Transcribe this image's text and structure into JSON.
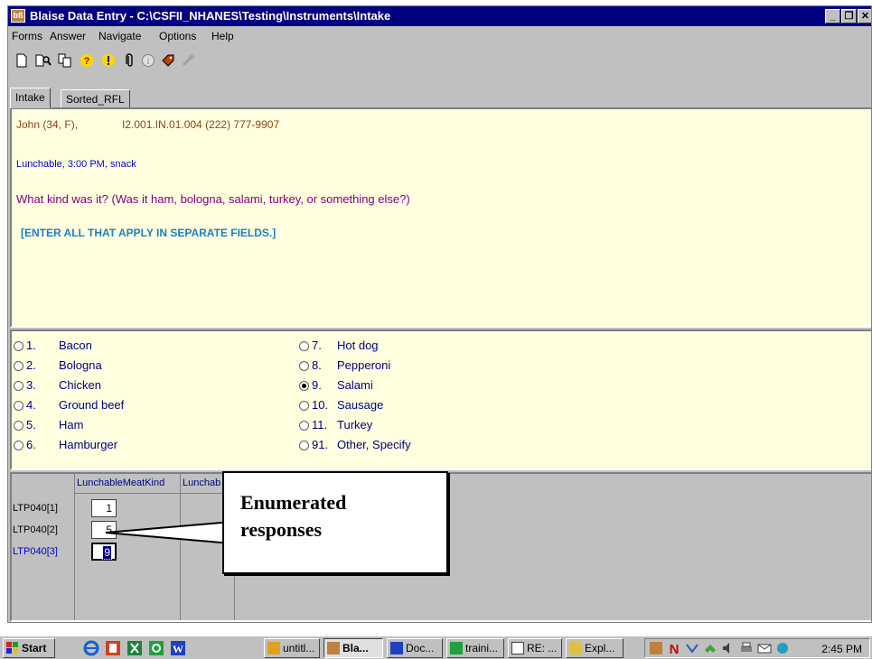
{
  "window": {
    "title": "Blaise Data Entry - C:\\CSFII_NHANES\\Testing\\Instruments\\Intake",
    "app_icon_text": "bß"
  },
  "menu": [
    "Forms",
    "Answer",
    "Navigate",
    "Options",
    "Help"
  ],
  "toolbar_icons": [
    "new-form-icon",
    "find-icon",
    "copy-icon",
    "help-icon",
    "info-icon",
    "paperclip-icon",
    "about-icon",
    "tag-icon",
    "ruler-icon"
  ],
  "tabs": [
    {
      "label": "Intake",
      "active": true
    },
    {
      "label": "Sorted_RFL",
      "active": false
    }
  ],
  "question": {
    "respondent": "John (34, F),",
    "identifier": "I2.001.IN.01.004  (222) 777-9907",
    "food_context": "Lunchable, 3:00 PM, snack",
    "text": "What kind was it? (Was it ham, bologna, salami, turkey, or something else?)",
    "instruction": "[ENTER ALL THAT APPLY IN SEPARATE FIELDS.]"
  },
  "options": [
    {
      "code": "1.",
      "label": "Bacon",
      "selected": false
    },
    {
      "code": "2.",
      "label": "Bologna",
      "selected": false
    },
    {
      "code": "3.",
      "label": "Chicken",
      "selected": false
    },
    {
      "code": "4.",
      "label": "Ground beef",
      "selected": false
    },
    {
      "code": "5.",
      "label": "Ham",
      "selected": false
    },
    {
      "code": "6.",
      "label": "Hamburger",
      "selected": false
    },
    {
      "code": "7.",
      "label": "Hot dog",
      "selected": false
    },
    {
      "code": "8.",
      "label": "Pepperoni",
      "selected": false
    },
    {
      "code": "9.",
      "label": "Salami",
      "selected": true
    },
    {
      "code": "10.",
      "label": "Sausage",
      "selected": false
    },
    {
      "code": "11.",
      "label": "Turkey",
      "selected": false
    },
    {
      "code": "91.",
      "label": "Other, Specify",
      "selected": false
    }
  ],
  "grid": {
    "columns": [
      "LunchableMeatKind",
      "Lunchab"
    ],
    "rows": [
      {
        "label": "LTP040[1]",
        "value": "1",
        "current": false
      },
      {
        "label": "LTP040[2]",
        "value": "5",
        "current": false
      },
      {
        "label": "LTP040[3]",
        "value": "9",
        "current": true
      }
    ]
  },
  "callout": {
    "text_line1": "Enumerated",
    "text_line2": "responses"
  },
  "taskbar": {
    "start_label": "Start",
    "buttons": [
      "untitl...",
      "Bla...",
      "Doc...",
      "traini...",
      "RE: ...",
      "Expl..."
    ],
    "clock": "2:45 PM"
  },
  "colors": {
    "titlebar": "#000080",
    "question_bg": "#ffffe0",
    "respondent_text": "#8b4513",
    "question_text": "#800080",
    "instruction_text": "#1e7fbf",
    "option_text": "#000080"
  }
}
